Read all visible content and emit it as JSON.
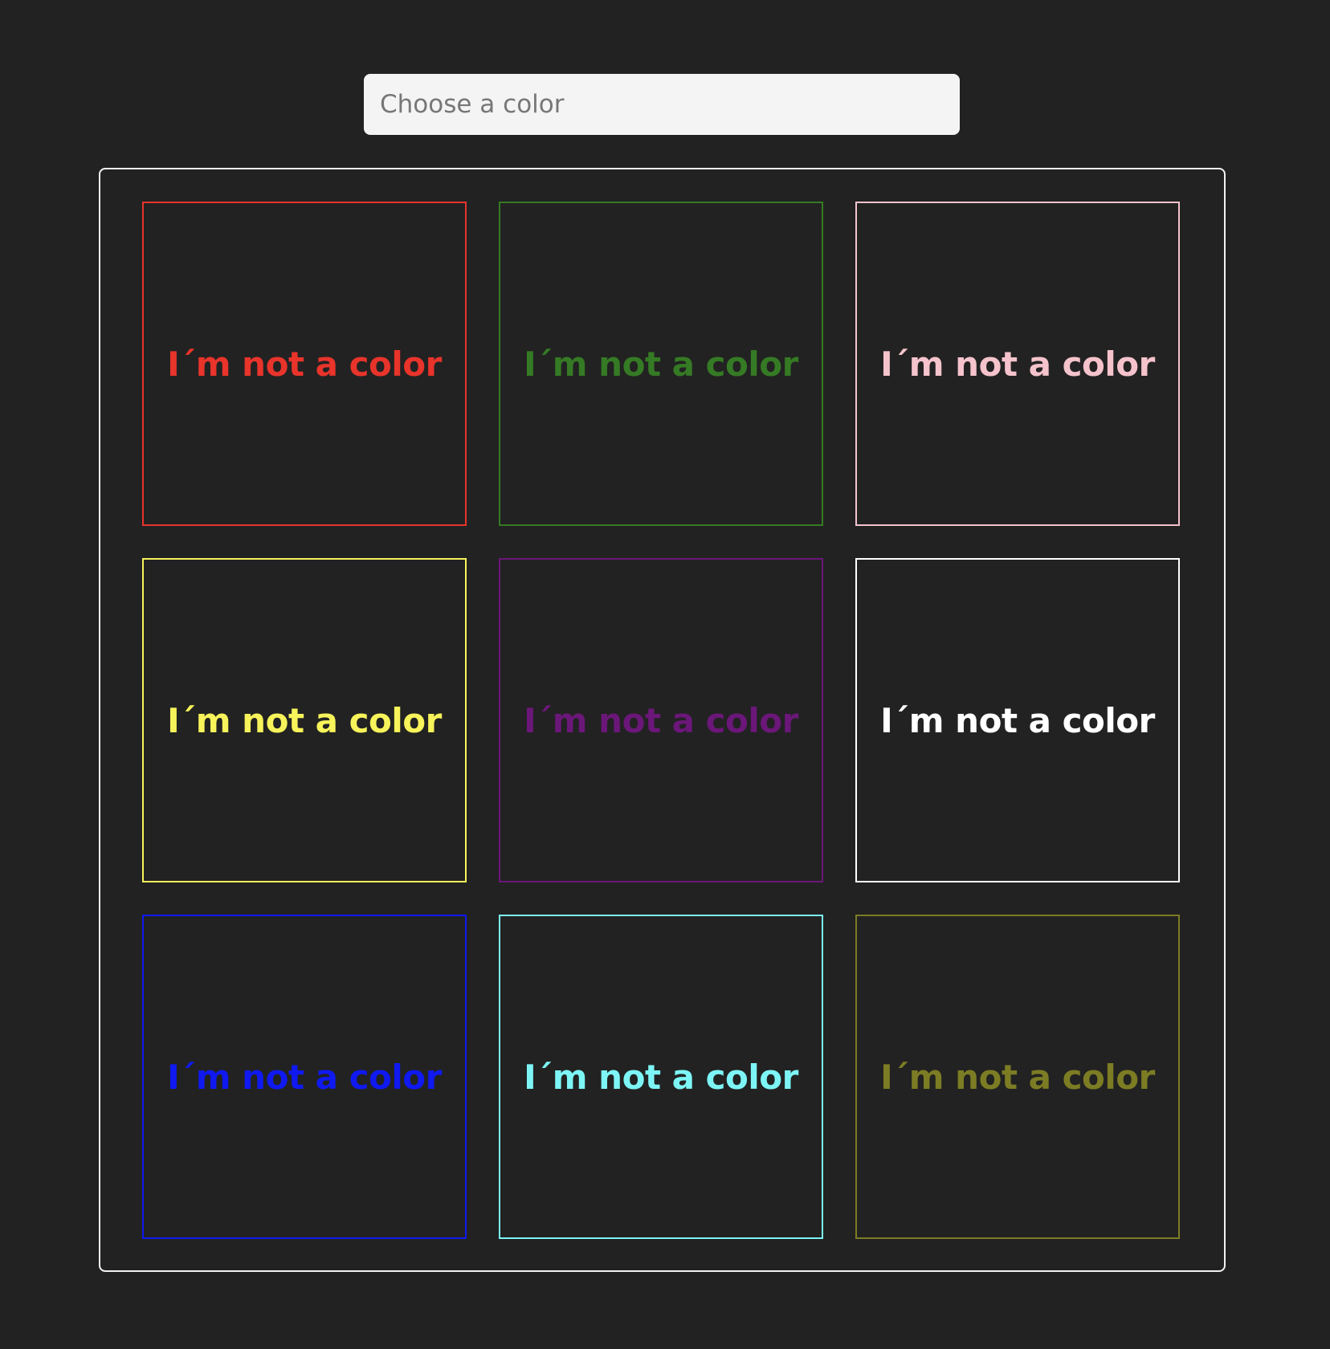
{
  "search": {
    "placeholder": "Choose a color",
    "value": ""
  },
  "tiles": [
    {
      "label": "I´m not a color",
      "color": "#e8342b"
    },
    {
      "label": "I´m not a color",
      "color": "#357a24"
    },
    {
      "label": "I´m not a color",
      "color": "#f5c3cc"
    },
    {
      "label": "I´m not a color",
      "color": "#f7f35a"
    },
    {
      "label": "I´m not a color",
      "color": "#6b1779"
    },
    {
      "label": "I´m not a color",
      "color": "#ffffff"
    },
    {
      "label": "I´m not a color",
      "color": "#0f19f0"
    },
    {
      "label": "I´m not a color",
      "color": "#7df5f6"
    },
    {
      "label": "I´m not a color",
      "color": "#7c7c24"
    }
  ]
}
